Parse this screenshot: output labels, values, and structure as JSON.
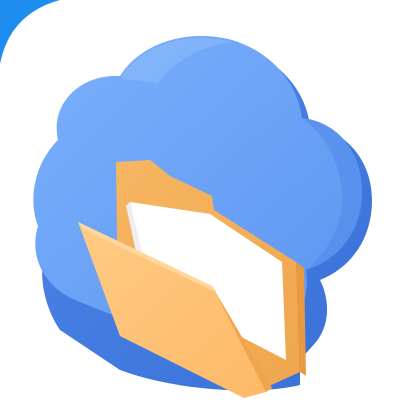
{
  "icon": {
    "name": "cloud-folder-app-icon",
    "colors": {
      "corner_accent": "#1E8DF0",
      "cloud_light": "#74A9FA",
      "cloud_mid": "#5A94F2",
      "cloud_dark": "#3F78DE",
      "folder_front": "#FFC47A",
      "folder_back": "#F5AE58",
      "folder_edge": "#E89A3E",
      "paper": "#FFFFFF",
      "background": "#FFFFFF"
    }
  }
}
